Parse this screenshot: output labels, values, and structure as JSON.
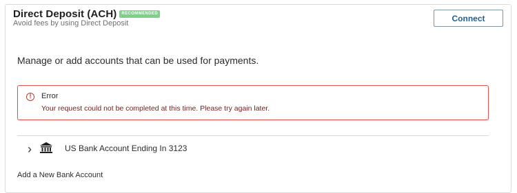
{
  "header": {
    "title": "Direct Deposit (ACH)",
    "badge": "RECOMMENDED",
    "subtitle": "Avoid fees by using Direct Deposit",
    "connect_label": "Connect"
  },
  "body": {
    "manage_text": "Manage or add accounts that can be used for payments."
  },
  "error": {
    "title": "Error",
    "message": "Your request could not be completed at this time. Please try again later.",
    "icon": "alert-circle-icon"
  },
  "accounts": [
    {
      "label": "US Bank Account Ending In 3123",
      "icon": "bank-icon"
    }
  ],
  "add_account_label": "Add a New Bank Account",
  "colors": {
    "badge_bg": "#7fd08a",
    "connect_text": "#1f5f96",
    "error_border": "#d9534f",
    "error_text": "#6b1f1f"
  }
}
